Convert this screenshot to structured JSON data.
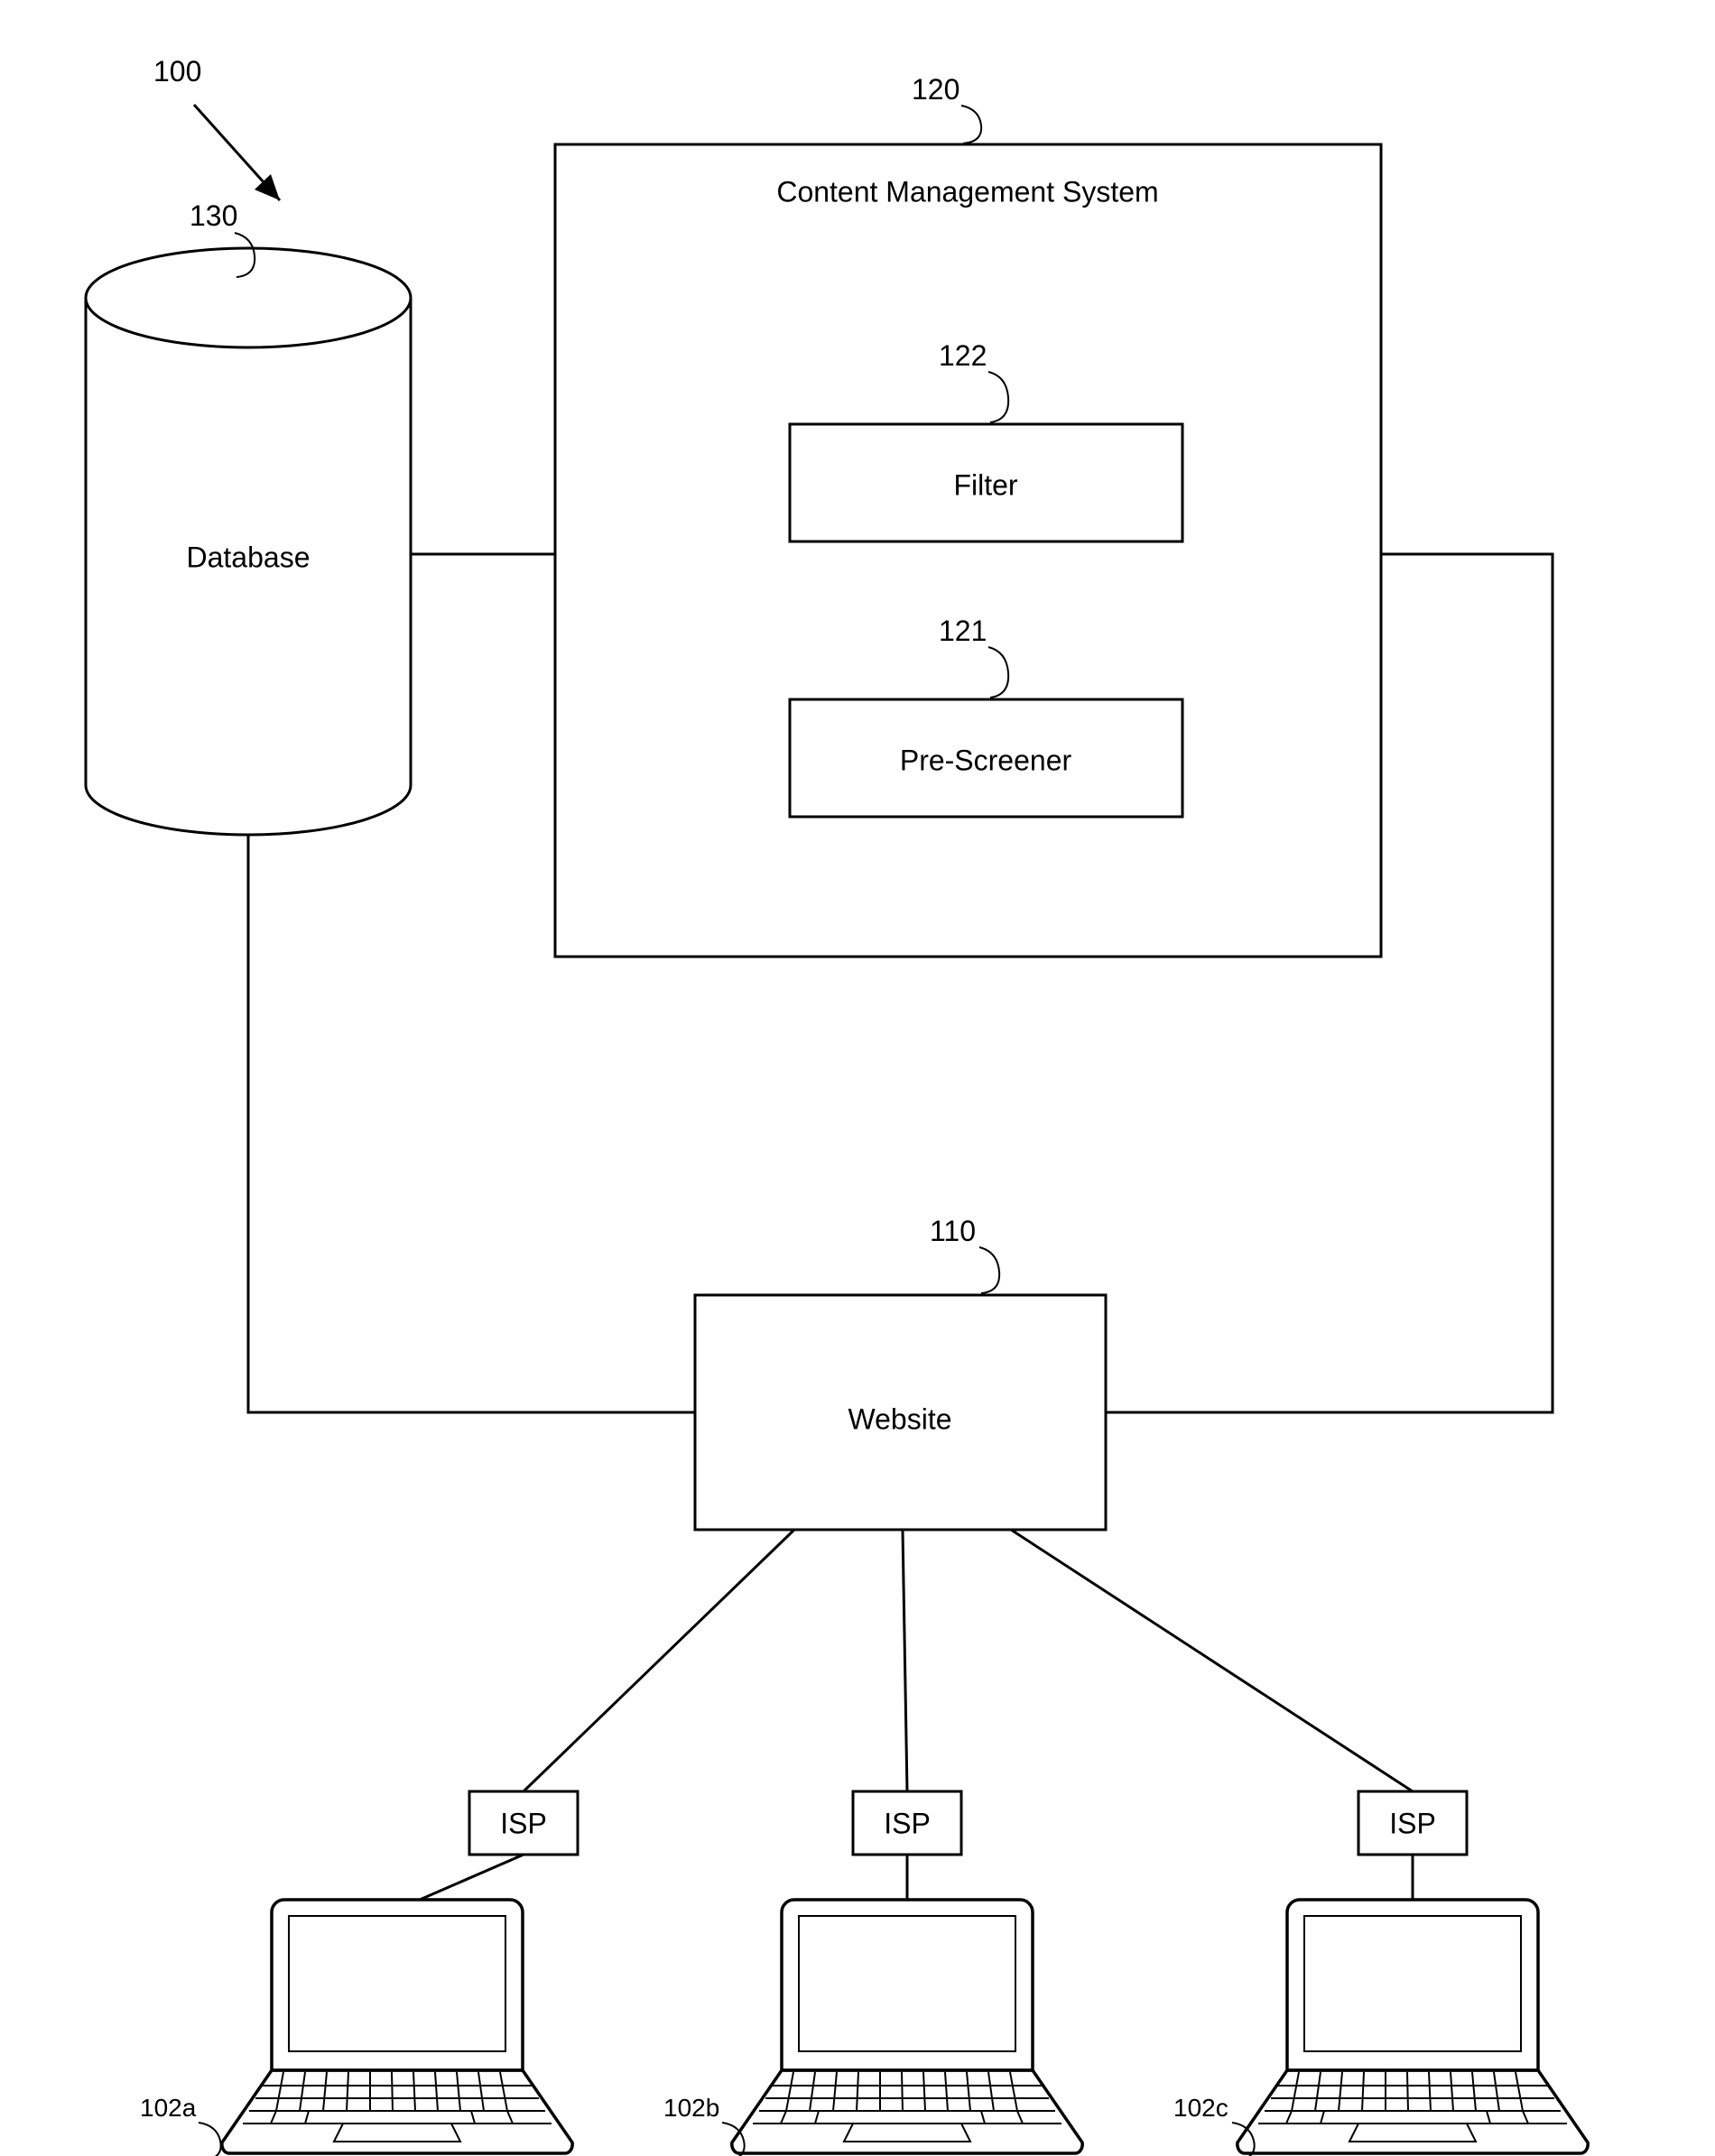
{
  "figure": {
    "ref_main": "100",
    "cms": {
      "ref": "120",
      "title": "Content Management System",
      "filter": {
        "ref": "122",
        "label": "Filter"
      },
      "prescreener": {
        "ref": "121",
        "label": "Pre-Screener"
      }
    },
    "database": {
      "ref": "130",
      "label": "Database"
    },
    "website": {
      "ref": "110",
      "label": "Website"
    },
    "isp_label": "ISP",
    "clients": {
      "a": {
        "ref": "102a"
      },
      "b": {
        "ref": "102b"
      },
      "c": {
        "ref": "102c"
      }
    }
  }
}
